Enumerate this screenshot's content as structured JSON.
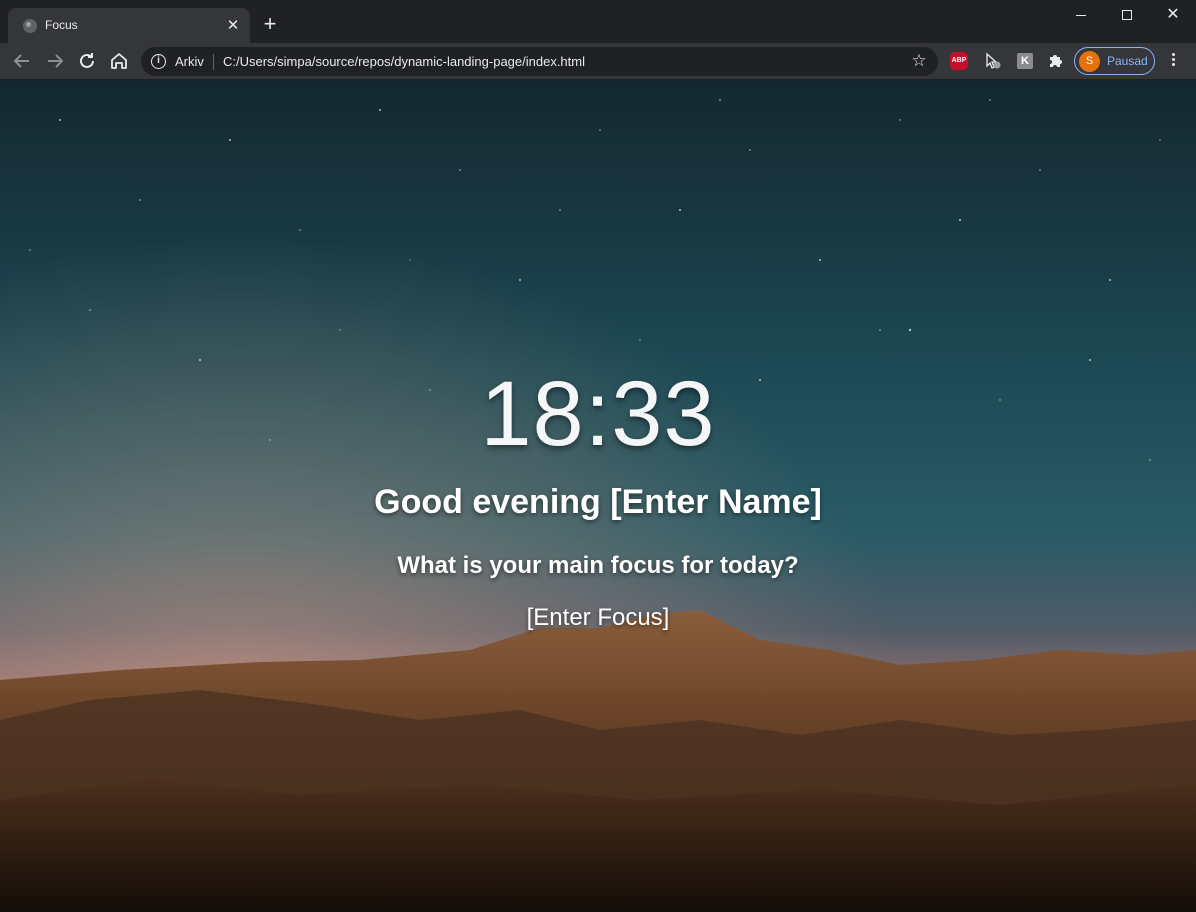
{
  "browser": {
    "tab": {
      "title": "Focus"
    },
    "omnibox": {
      "site_label": "Arkiv",
      "url": "C:/Users/simpa/source/repos/dynamic-landing-page/index.html"
    },
    "extensions": [
      {
        "name": "adblock-plus-icon",
        "label": "ABP"
      },
      {
        "name": "cursor-extension-icon"
      },
      {
        "name": "k-extension-icon",
        "label": "K"
      },
      {
        "name": "puzzle-icon"
      }
    ],
    "profile": {
      "initial": "S",
      "label": "Pausad"
    }
  },
  "page": {
    "time": "18:33",
    "greeting": "Good evening",
    "name": "[Enter Name]",
    "focus_question": "What is your main focus for today?",
    "focus": "[Enter Focus]"
  },
  "colors": {
    "chrome_dark": "#202124",
    "chrome_toolbar": "#35363a",
    "profile_accent": "#8ab4f8",
    "avatar": "#e8710a",
    "abp_red": "#c70d2c"
  }
}
